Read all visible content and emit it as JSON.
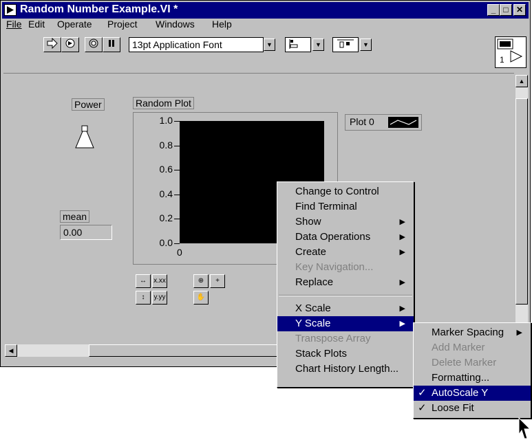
{
  "window": {
    "title": "Random Number Example.VI *",
    "min_label": "_",
    "max_label": "□",
    "close_label": "✕"
  },
  "menubar": {
    "items": [
      "File",
      "Edit",
      "Operate",
      "Project",
      "Windows",
      "Help"
    ]
  },
  "toolbar": {
    "font_select": "13pt Application Font",
    "connector_label": "1"
  },
  "panel": {
    "power_label": "Power",
    "mean_label": "mean",
    "mean_value": "0.00",
    "chart_label": "Random Plot",
    "legend_label": "Plot 0",
    "y_ticks": [
      "1.0",
      "0.8",
      "0.6",
      "0.4",
      "0.2",
      "0.0"
    ],
    "x_tick": "0"
  },
  "chart_data": {
    "type": "line",
    "title": "Random Plot",
    "series": [
      {
        "name": "Plot 0",
        "values": []
      }
    ],
    "ylim": [
      0.0,
      1.0
    ],
    "y_ticks": [
      1.0,
      0.8,
      0.6,
      0.4,
      0.2,
      0.0
    ],
    "x_ticks": [
      0
    ]
  },
  "context_menu": {
    "items": [
      {
        "label": "Change to Control",
        "disabled": false,
        "submenu": false
      },
      {
        "label": "Find Terminal",
        "disabled": false,
        "submenu": false
      },
      {
        "label": "Show",
        "disabled": false,
        "submenu": true
      },
      {
        "label": "Data Operations",
        "disabled": false,
        "submenu": true
      },
      {
        "label": "Create",
        "disabled": false,
        "submenu": true
      },
      {
        "label": "Key Navigation...",
        "disabled": true,
        "submenu": false
      },
      {
        "label": "Replace",
        "disabled": false,
        "submenu": true
      }
    ],
    "items2": [
      {
        "label": "X Scale",
        "disabled": false,
        "submenu": true,
        "selected": false
      },
      {
        "label": "Y Scale",
        "disabled": false,
        "submenu": true,
        "selected": true
      },
      {
        "label": "Transpose Array",
        "disabled": true,
        "submenu": false,
        "selected": false
      },
      {
        "label": "Stack Plots",
        "disabled": false,
        "submenu": false,
        "selected": false
      },
      {
        "label": "Chart History Length...",
        "disabled": false,
        "submenu": false,
        "selected": false
      }
    ]
  },
  "submenu": {
    "items": [
      {
        "label": "Marker Spacing",
        "disabled": false,
        "submenu": true,
        "checked": false,
        "selected": false
      },
      {
        "label": "Add Marker",
        "disabled": true,
        "submenu": false,
        "checked": false,
        "selected": false
      },
      {
        "label": "Delete Marker",
        "disabled": true,
        "submenu": false,
        "checked": false,
        "selected": false
      },
      {
        "label": "Formatting...",
        "disabled": false,
        "submenu": false,
        "checked": false,
        "selected": false
      },
      {
        "label": "AutoScale Y",
        "disabled": false,
        "submenu": false,
        "checked": true,
        "selected": true
      },
      {
        "label": "Loose Fit",
        "disabled": false,
        "submenu": false,
        "checked": true,
        "selected": false
      }
    ]
  },
  "colors": {
    "title_bg": "#000080",
    "face": "#c0c0c0",
    "plot_bg": "#000000"
  }
}
